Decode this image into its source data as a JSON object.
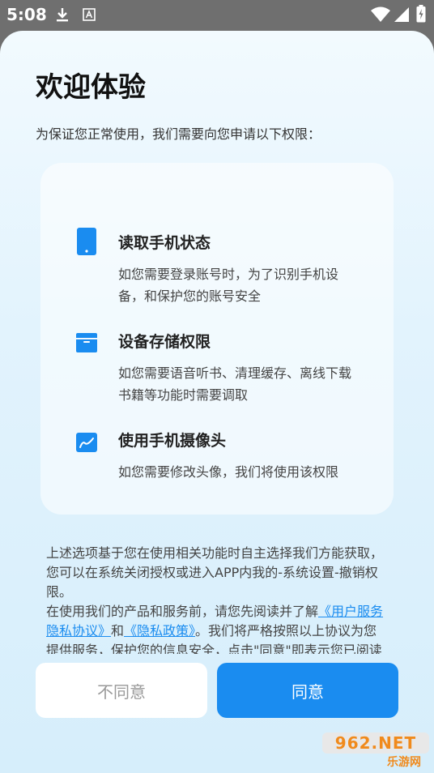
{
  "status_bar": {
    "time": "5:08"
  },
  "dialog": {
    "title": "欢迎体验",
    "subtitle": "为保证您正常使用，我们需要向您申请以下权限：",
    "permissions": [
      {
        "icon": "phone-icon",
        "title": "读取手机状态",
        "desc": "如您需要登录账号时，为了识别手机设备，和保护您的账号安全"
      },
      {
        "icon": "storage-icon",
        "title": "设备存储权限",
        "desc": "如您需要语音听书、清理缓存、离线下载书籍等功能时需要调取"
      },
      {
        "icon": "camera-icon",
        "title": "使用手机摄像头",
        "desc": "如您需要修改头像，我们将使用该权限"
      }
    ],
    "notice": {
      "para1": "上述选项基于您在使用相关功能时自主选择我们方能获取，您可以在系统关闭授权或进入APP内我的-系统设置-撤销权限。",
      "para2_prefix": "在使用我们的产品和服务前，请您先阅读并了解",
      "user_agreement_link": "《用户服务隐私协议》",
      "para2_and": "和",
      "privacy_policy_link": "《隐私政策》",
      "para2_suffix": "。我们将严格按照以上协议为您提供服务，保护您的信息安全，点击\"同意\"即表示您已阅读并同意全部条款。"
    },
    "buttons": {
      "reject": "不同意",
      "accept": "同意"
    }
  },
  "watermark": {
    "top": "962.NET",
    "bottom": "乐游网"
  },
  "colors": {
    "accent": "#1a8cf0",
    "watermark": "#f08a1c"
  }
}
